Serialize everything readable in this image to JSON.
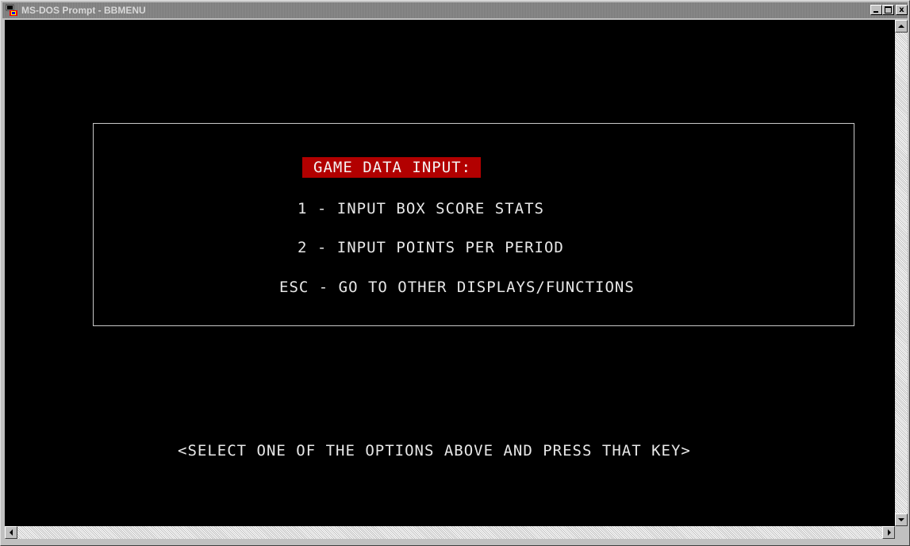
{
  "window": {
    "title": "MS-DOS Prompt - BBMENU"
  },
  "title_buttons": {
    "minimize_icon": "minimize-icon",
    "maximize_icon": "maximize-icon",
    "close_glyph": "x"
  },
  "menu": {
    "heading": "GAME DATA INPUT:",
    "options": [
      "1 - INPUT BOX SCORE STATS",
      "2 - INPUT POINTS PER PERIOD",
      "ESC - GO TO OTHER DISPLAYS/FUNCTIONS"
    ],
    "prompt": "<SELECT ONE OF THE OPTIONS ABOVE AND PRESS THAT KEY>"
  },
  "colors": {
    "console_bg": "#000000",
    "console_text": "#e8e8e8",
    "heading_bg": "#b20000",
    "titlebar_inactive": "#808080"
  }
}
